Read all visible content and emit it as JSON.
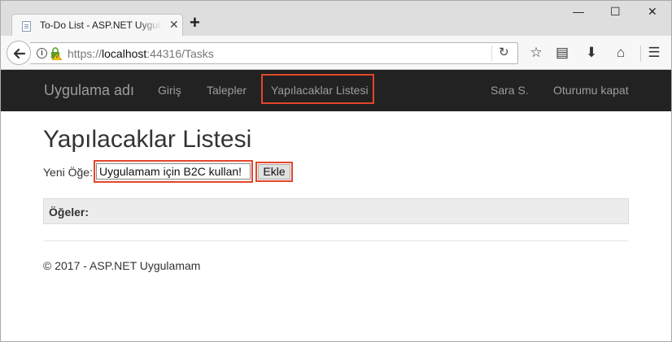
{
  "browser": {
    "tab_title": "To-Do List - ASP.NET Uygulamam",
    "tab_close": "✕",
    "new_tab": "+",
    "window_controls": {
      "minimize": "—",
      "maximize": "☐",
      "close": "✕"
    },
    "url_scheme": "https://",
    "url_host": "localhost",
    "url_rest": ":44316/Tasks",
    "icons": [
      "back-arrow-icon",
      "info-icon",
      "lock-warning-icon",
      "reload-icon",
      "star-icon",
      "reading-list-icon",
      "download-icon",
      "home-icon",
      "menu-icon"
    ]
  },
  "navbar": {
    "brand": "Uygulama adı",
    "links": [
      "Giriş",
      "Talepler",
      "Yapılacaklar Listesi"
    ],
    "user": "Sara S.",
    "logout": "Oturumu kapat"
  },
  "main": {
    "title": "Yapılacaklar Listesi",
    "new_item_label": "Yeni Öğe:",
    "new_item_value": "Uygulamam için B2C kullan!",
    "add_button": "Ekle",
    "items_header": "Öğeler:"
  },
  "footer": {
    "text": "© 2017 - ASP.NET Uygulamam"
  },
  "colors": {
    "navbar_bg": "#222222",
    "highlight": "#e2462c",
    "panel_bg": "#ececec"
  }
}
